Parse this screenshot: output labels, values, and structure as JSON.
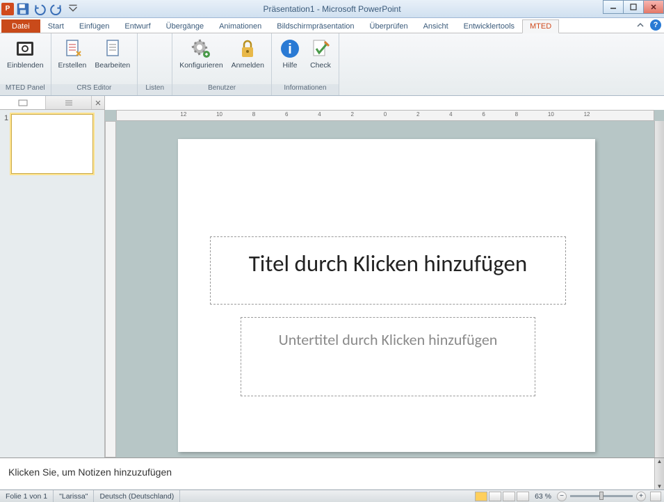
{
  "window": {
    "title": "Präsentation1 - Microsoft PowerPoint"
  },
  "qat": {
    "app_letter": "P"
  },
  "tabs": {
    "file": "Datei",
    "items": [
      "Start",
      "Einfügen",
      "Entwurf",
      "Übergänge",
      "Animationen",
      "Bildschirmpräsentation",
      "Überprüfen",
      "Ansicht",
      "Entwicklertools",
      "MTED"
    ],
    "active": "MTED"
  },
  "ribbon": {
    "groups": [
      {
        "label": "MTED Panel",
        "buttons": [
          {
            "name": "einblenden",
            "label": "Einblenden"
          }
        ]
      },
      {
        "label": "CRS Editor",
        "buttons": [
          {
            "name": "erstellen",
            "label": "Erstellen"
          },
          {
            "name": "bearbeiten",
            "label": "Bearbeiten"
          }
        ]
      },
      {
        "label": "Listen",
        "buttons": []
      },
      {
        "label": "Benutzer",
        "buttons": [
          {
            "name": "konfigurieren",
            "label": "Konfigurieren"
          },
          {
            "name": "anmelden",
            "label": "Anmelden"
          }
        ]
      },
      {
        "label": "Informationen",
        "buttons": [
          {
            "name": "hilfe",
            "label": "Hilfe"
          },
          {
            "name": "check",
            "label": "Check"
          }
        ]
      }
    ]
  },
  "thumbs": {
    "slide_num": "1"
  },
  "ruler": {
    "h_numbers": [
      "12",
      "10",
      "8",
      "6",
      "4",
      "2",
      "0",
      "2",
      "4",
      "6",
      "8",
      "10",
      "12"
    ]
  },
  "slide": {
    "title_placeholder": "Titel durch Klicken hinzufügen",
    "subtitle_placeholder": "Untertitel durch Klicken hinzufügen"
  },
  "notes": {
    "placeholder": "Klicken Sie, um Notizen hinzuzufügen"
  },
  "status": {
    "slide_info": "Folie 1 von 1",
    "theme": "\"Larissa\"",
    "language": "Deutsch (Deutschland)",
    "zoom": "63 %"
  }
}
